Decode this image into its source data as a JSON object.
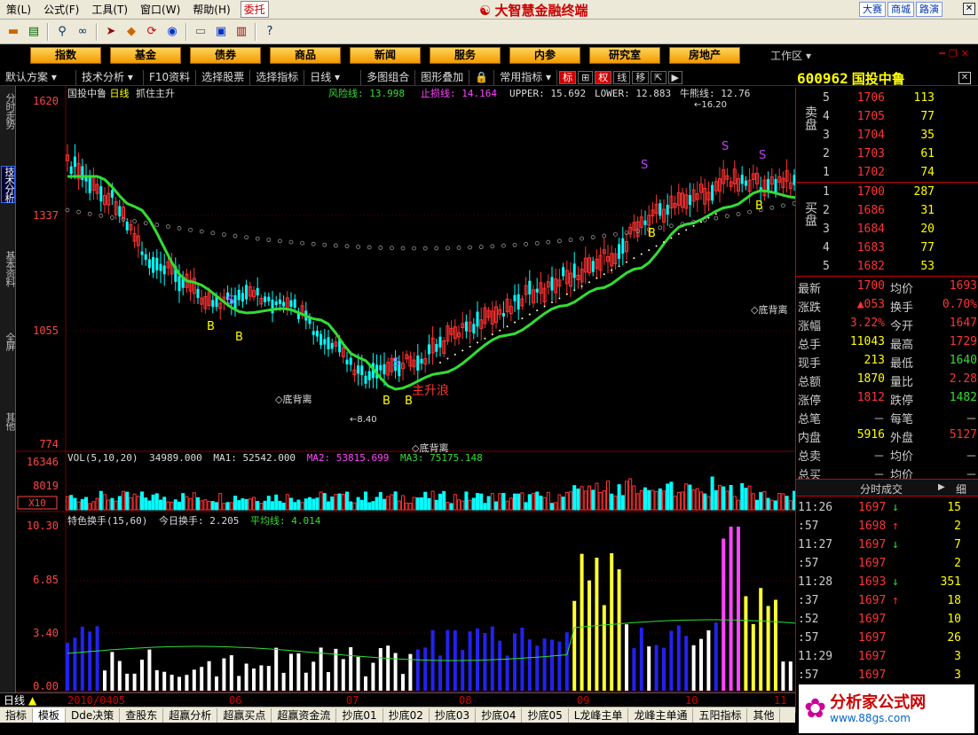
{
  "menubar": {
    "items": [
      "策(L)",
      "公式(F)",
      "工具(T)",
      "窗口(W)",
      "帮助(H)"
    ],
    "trust_label": "委托",
    "app_title": "大智慧金融终端",
    "right_buttons": [
      "大赛",
      "商城",
      "路演"
    ]
  },
  "nav": {
    "buttons": [
      "指数",
      "基金",
      "债券",
      "商品",
      "新闻",
      "服务",
      "内参",
      "研究室",
      "房地产"
    ],
    "workspace": "工作区"
  },
  "subbar": {
    "items": [
      "默认方案",
      "技术分析",
      "F10资料",
      "选择股票",
      "选择指标",
      "日线",
      "多图组合",
      "图形叠加",
      "常用指标"
    ],
    "toggles": [
      "标",
      "权",
      "线",
      "移"
    ]
  },
  "lefttabs": [
    "分时走势",
    "技术分析",
    "基本资料",
    "全屏",
    "其他"
  ],
  "stock": {
    "code": "600962",
    "name": "国投中鲁"
  },
  "main_chart": {
    "header": {
      "name": "国投中鲁",
      "period": "日线",
      "formula": "抓住主升",
      "risk_label": "风险线: 13.998",
      "stoploss_label": "止损线: 14.164",
      "upper_label": "UPPER: 15.692",
      "lower_label": "LOWER: 12.883",
      "bull_label": "牛熊线: 12.76"
    },
    "y_labels": [
      "1620",
      "1337",
      "1055",
      "774"
    ],
    "annotations": {
      "high_mark": "16.20",
      "low_mark": "8.40",
      "main_wave": "主升浪",
      "diverge": "◇底背离",
      "buy": "B",
      "sell": "S"
    }
  },
  "vol_chart": {
    "header": "VOL(5,10,20)",
    "value": "34989.000",
    "ma1": "MA1: 52542.000",
    "ma2": "MA2: 53815.699",
    "ma3": "MA3: 75175.148",
    "y_labels": [
      "16346",
      "8019"
    ],
    "unit": "X10"
  },
  "turnover_chart": {
    "header": "特色换手(15,60)",
    "today": "今日换手: 2.205",
    "avg": "平均线: 4.014",
    "y_labels": [
      "10.30",
      "6.85",
      "3.40",
      "0.00"
    ]
  },
  "bottom": {
    "period": "日线",
    "dates": [
      "2010/0405",
      "06",
      "07",
      "08",
      "09",
      "10",
      "11"
    ]
  },
  "tabs": [
    "指标",
    "模板",
    "Dde决策",
    "查股东",
    "超赢分析",
    "超赢买点",
    "超赢资金流",
    "抄底01",
    "抄底02",
    "抄底03",
    "抄底04",
    "抄底05",
    "L龙峰主单",
    "龙峰主单通",
    "五阳指标",
    "其他"
  ],
  "orderbook": {
    "sell_label": "卖盘",
    "buy_label": "买盘",
    "sells": [
      {
        "lvl": "5",
        "price": "1706",
        "vol": "113"
      },
      {
        "lvl": "4",
        "price": "1705",
        "vol": "77"
      },
      {
        "lvl": "3",
        "price": "1704",
        "vol": "35"
      },
      {
        "lvl": "2",
        "price": "1703",
        "vol": "61"
      },
      {
        "lvl": "1",
        "price": "1702",
        "vol": "74"
      }
    ],
    "buys": [
      {
        "lvl": "1",
        "price": "1700",
        "vol": "287"
      },
      {
        "lvl": "2",
        "price": "1686",
        "vol": "31"
      },
      {
        "lvl": "3",
        "price": "1684",
        "vol": "20"
      },
      {
        "lvl": "4",
        "price": "1683",
        "vol": "77"
      },
      {
        "lvl": "5",
        "price": "1682",
        "vol": "53"
      }
    ]
  },
  "quote": [
    {
      "l1": "最新",
      "v1": "1700",
      "l2": "均价",
      "v2": "1693"
    },
    {
      "l1": "涨跌",
      "v1": "▲053",
      "l2": "换手",
      "v2": "0.70%"
    },
    {
      "l1": "涨幅",
      "v1": "3.22%",
      "l2": "今开",
      "v2": "1647"
    },
    {
      "l1": "总手",
      "v1": "11043",
      "l2": "最高",
      "v2": "1729"
    },
    {
      "l1": "现手",
      "v1": "213",
      "l2": "最低",
      "v2": "1640"
    },
    {
      "l1": "总额",
      "v1": "1870",
      "l2": "量比",
      "v2": "2.28"
    },
    {
      "l1": "涨停",
      "v1": "1812",
      "l2": "跌停",
      "v2": "1482"
    },
    {
      "l1": "总笔",
      "v1": "－",
      "l2": "每笔",
      "v2": "－"
    },
    {
      "l1": "内盘",
      "v1": "5916",
      "l2": "外盘",
      "v2": "5127"
    },
    {
      "l1": "总卖",
      "v1": "－",
      "l2": "均价",
      "v2": "－"
    },
    {
      "l1": "总买",
      "v1": "－",
      "l2": "均价",
      "v2": "－"
    }
  ],
  "ticks": {
    "header": "分时成交",
    "detail": "细",
    "rows": [
      {
        "time": "11:26",
        "price": "1697",
        "dir": "↓",
        "vol": "15"
      },
      {
        "time": ":57",
        "price": "1698",
        "dir": "↑",
        "vol": "2"
      },
      {
        "time": "11:27",
        "price": "1697",
        "dir": "↓",
        "vol": "7"
      },
      {
        "time": ":57",
        "price": "1697",
        "dir": "",
        "vol": "2"
      },
      {
        "time": "11:28",
        "price": "1693",
        "dir": "↓",
        "vol": "351"
      },
      {
        "time": ":37",
        "price": "1697",
        "dir": "↑",
        "vol": "18"
      },
      {
        "time": ":52",
        "price": "1697",
        "dir": "",
        "vol": "10"
      },
      {
        "time": ":57",
        "price": "1697",
        "dir": "",
        "vol": "26"
      },
      {
        "time": "11:29",
        "price": "1697",
        "dir": "",
        "vol": "3"
      },
      {
        "time": ":57",
        "price": "1697",
        "dir": "",
        "vol": "3"
      }
    ]
  },
  "logo": {
    "text": "分析家公式网",
    "url": "www.88gs.com"
  },
  "colors": {
    "up": "#ff3333",
    "down": "#00ffff",
    "ma": "#33dd33",
    "yellow": "#ffff00",
    "magenta": "#ff44ff"
  }
}
